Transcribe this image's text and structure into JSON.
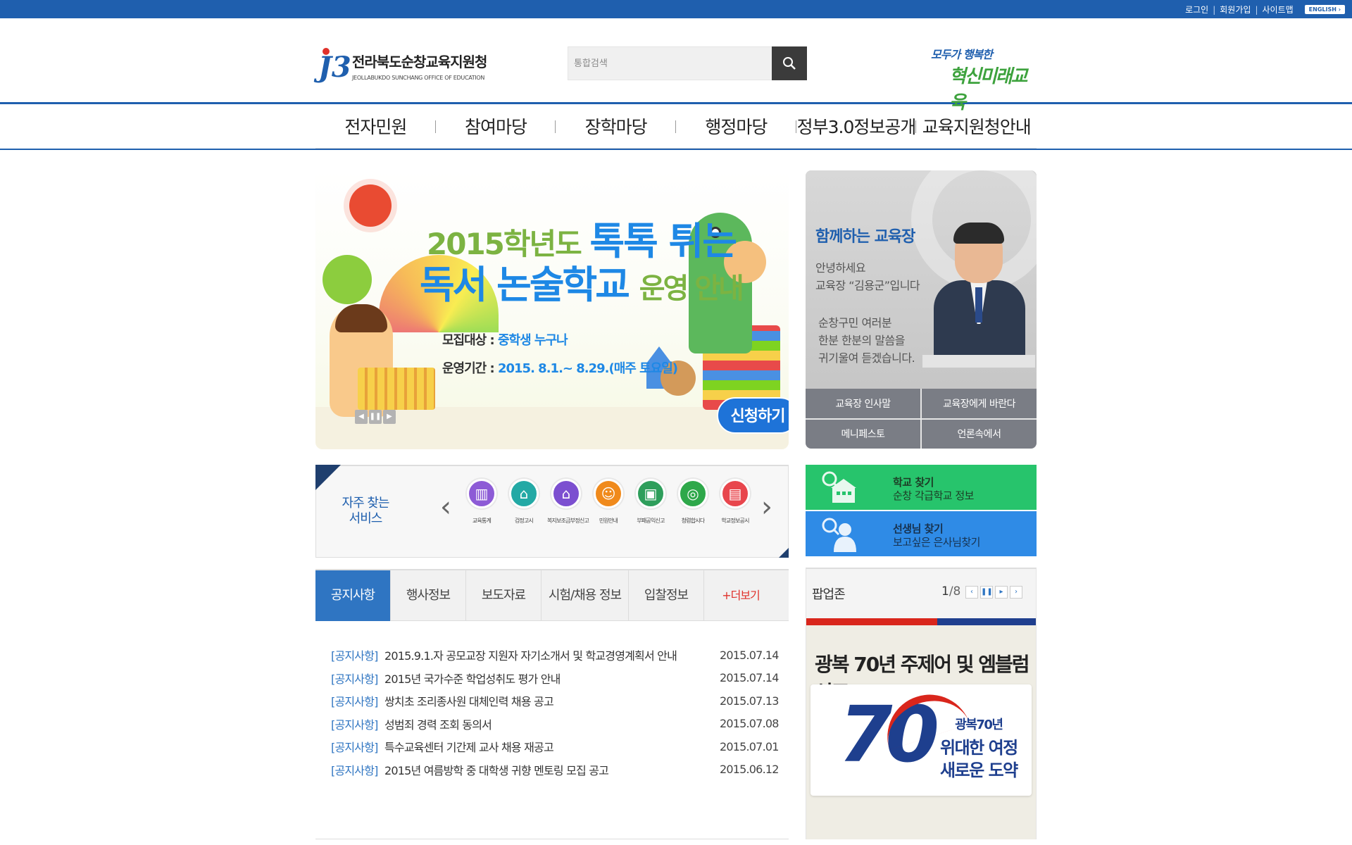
{
  "utility": {
    "login": "로그인",
    "join": "회원가입",
    "sitemap": "사이트맵",
    "english": "ENGLISH ›"
  },
  "header": {
    "logo_kr": "전라북도순창교육지원청",
    "logo_en": "JEOLLABUKDO SUNCHANG OFFICE OF EDUCATION",
    "search_placeholder": "통합검색",
    "slogan_line1": "모두가 행복한",
    "slogan_line2": "혁신미래교육"
  },
  "gnb": [
    "전자민원",
    "참여마당",
    "장학마당",
    "행정마당",
    "정부3.0정보공개",
    "교육지원청안내"
  ],
  "banner": {
    "year": "2015학년도",
    "headline1": "톡톡 튀는",
    "headline2": "독서 논술학교",
    "headline2_sm": "운영 안내",
    "target_label": "모집대상 : ",
    "target_value": "중학생 누구나",
    "period_label": "운영기간 : ",
    "period_value": "2015. 8.1.~ 8.29.(매주 토요일)",
    "apply": "신청하기",
    "controls": [
      "◀",
      "❚❚",
      "▶"
    ]
  },
  "superintendent": {
    "title": "함께하는 교육장",
    "greeting": [
      "안녕하세요",
      "교육장 “김용군”입니다"
    ],
    "message": [
      "순창구민 여러분",
      "한분 한분의 말씀을",
      "귀기울여 듣겠습니다."
    ],
    "buttons": [
      "교육장 인사말",
      "교육장에게 바란다",
      "메니페스토",
      "언론속에서"
    ]
  },
  "quick": {
    "label": [
      "자주 찾는",
      "서비스"
    ],
    "prev": "‹",
    "next": "›",
    "items": [
      {
        "label": "교육통계",
        "color": "#8d5bd6"
      },
      {
        "label": "검정고시",
        "color": "#23a9a5"
      },
      {
        "label": "복지보조금부정신고",
        "color": "#7c4fd0"
      },
      {
        "label": "민원안내",
        "color": "#f08a1c"
      },
      {
        "label": "부패공익신고",
        "color": "#2e9e5b"
      },
      {
        "label": "청렴합시다",
        "color": "#2ea84a"
      },
      {
        "label": "학교정보공시",
        "color": "#e8464d"
      }
    ]
  },
  "find": {
    "school_title": "학교 찾기",
    "school_sub": "순창 각급학교 정보",
    "teacher_title": "선생님 찾기",
    "teacher_sub": "보고싶은 은사님찾기"
  },
  "board": {
    "tabs": [
      "공지사항",
      "행사정보",
      "보도자료",
      "시험/채용 정보",
      "입찰정보"
    ],
    "more": "+더보기",
    "notices": [
      {
        "cat": "[공지사항]",
        "title": "2015.9.1.자 공모교장 지원자 자기소개서 및 학교경영계획서 안내",
        "date": "2015.07.14"
      },
      {
        "cat": "[공지사항]",
        "title": "2015년 국가수준 학업성취도 평가 안내",
        "date": "2015.07.14"
      },
      {
        "cat": "[공지사항]",
        "title": "쌍치초 조리종사원 대체인력 채용 공고",
        "date": "2015.07.13"
      },
      {
        "cat": "[공지사항]",
        "title": "성범죄 경력 조회 동의서",
        "date": "2015.07.08"
      },
      {
        "cat": "[공지사항]",
        "title": "특수교육센터 기간제 교사 채용 재공고",
        "date": "2015.07.01"
      },
      {
        "cat": "[공지사항]",
        "title": "2015년 여름방학 중 대학생 귀향 멘토링 모집 공고",
        "date": "2015.06.12"
      }
    ]
  },
  "popup": {
    "label": "팝업존",
    "page": "1",
    "total": "/8",
    "controls": [
      "‹",
      "❚❚",
      "▸",
      "›"
    ],
    "headline": "광복 70년 주제어 및 엠블럼 선포",
    "emblem_number": "70",
    "emblem_line1": "광복70년",
    "emblem_line2": "위대한 여정",
    "emblem_line3": "새로운 도약"
  }
}
